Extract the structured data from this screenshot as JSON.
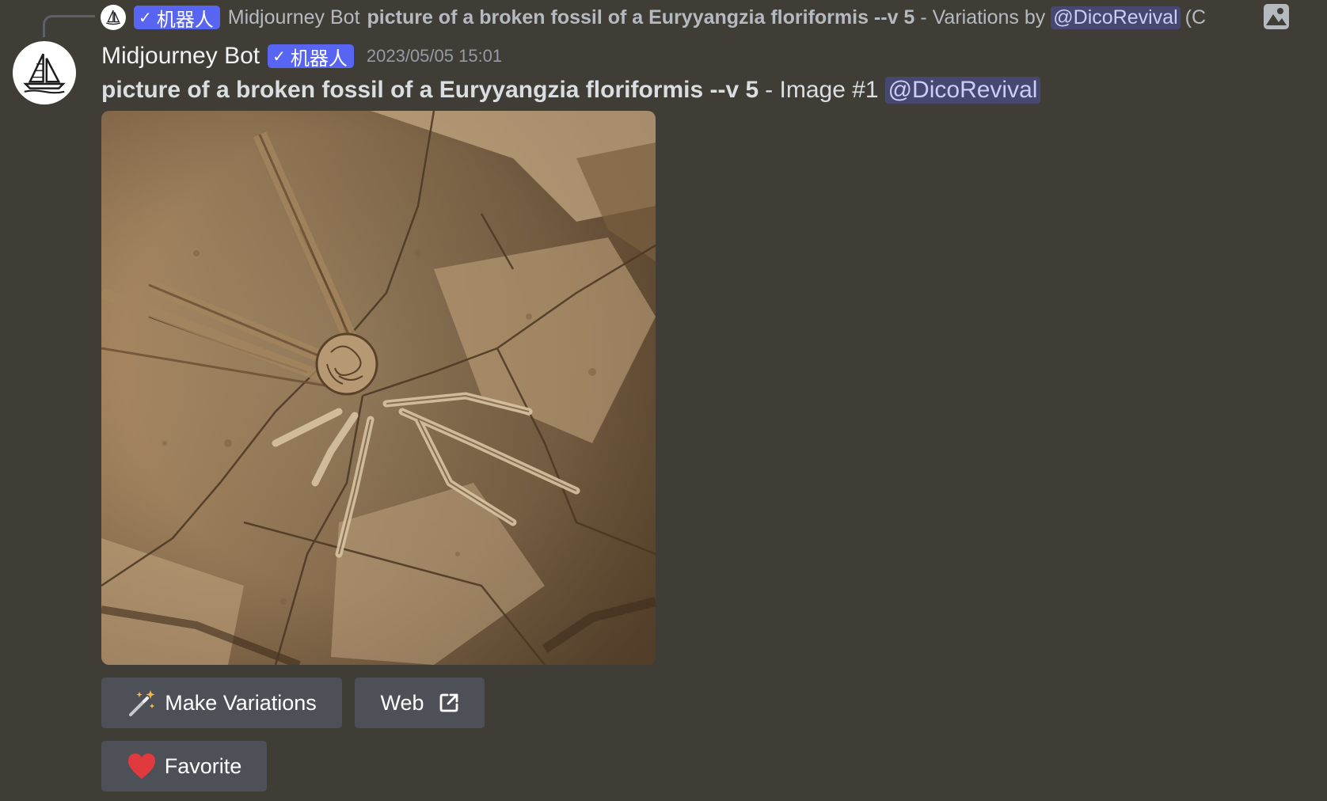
{
  "reply": {
    "badge_label": "机器人",
    "author": "Midjourney Bot",
    "prompt": "picture of a broken fossil of a Euryyangzia floriformis --v 5",
    "suffix": "- Variations by",
    "mention": "@DicoRevival",
    "tail": "(C"
  },
  "message": {
    "author": "Midjourney Bot",
    "badge_label": "机器人",
    "timestamp": "2023/05/05 15:01",
    "prompt": "picture of a broken fossil of a Euryyangzia floriformis --v 5",
    "suffix": "- Image #1",
    "mention": "@DicoRevival",
    "image_alt": "broken fossil of a Euryyangzia floriformis"
  },
  "buttons": {
    "make_variations": "Make Variations",
    "web": "Web",
    "favorite": "Favorite"
  },
  "icons": {
    "avatar": "sailboat-logo-icon",
    "verified": "checkmark-icon",
    "reply_image": "image-icon",
    "variations": "magic-wand-icon",
    "web": "external-link-icon",
    "favorite": "heart-icon"
  },
  "colors": {
    "background": "#403d37",
    "badge": "#5865f2",
    "button": "#4e5058",
    "mention_text": "#c9cdfb",
    "heart": "#e03a3e"
  }
}
